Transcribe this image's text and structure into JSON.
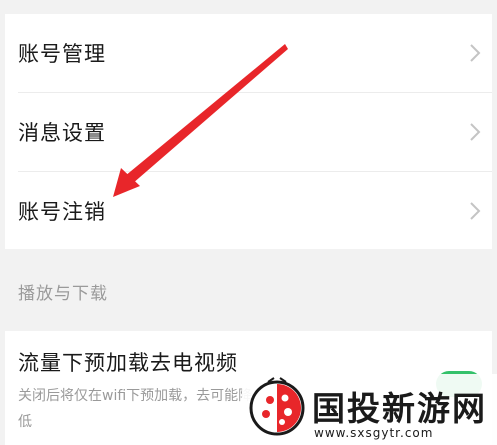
{
  "settings": {
    "items": [
      {
        "label": "账号管理",
        "icon": "chevron-right-icon"
      },
      {
        "label": "消息设置",
        "icon": "chevron-right-icon"
      },
      {
        "label": "账号注销",
        "icon": "chevron-right-icon"
      }
    ]
  },
  "section": {
    "title": "播放与下载"
  },
  "video_item": {
    "title": "流量下预加载去电视频",
    "description": "关闭后将仅在wifi下预加载，去可能降低",
    "toggle_state": "on"
  },
  "annotation": {
    "color": "#e8262a",
    "icon": "red-arrow"
  },
  "watermark": {
    "brand": "国投新游网",
    "url": "www.sxsgytr.com",
    "icon": "ladybug-logo"
  },
  "colors": {
    "toggle_on": "#34c16a",
    "background": "#f2f2f2",
    "text": "#1a1a1a",
    "muted": "#9a9a9a"
  }
}
